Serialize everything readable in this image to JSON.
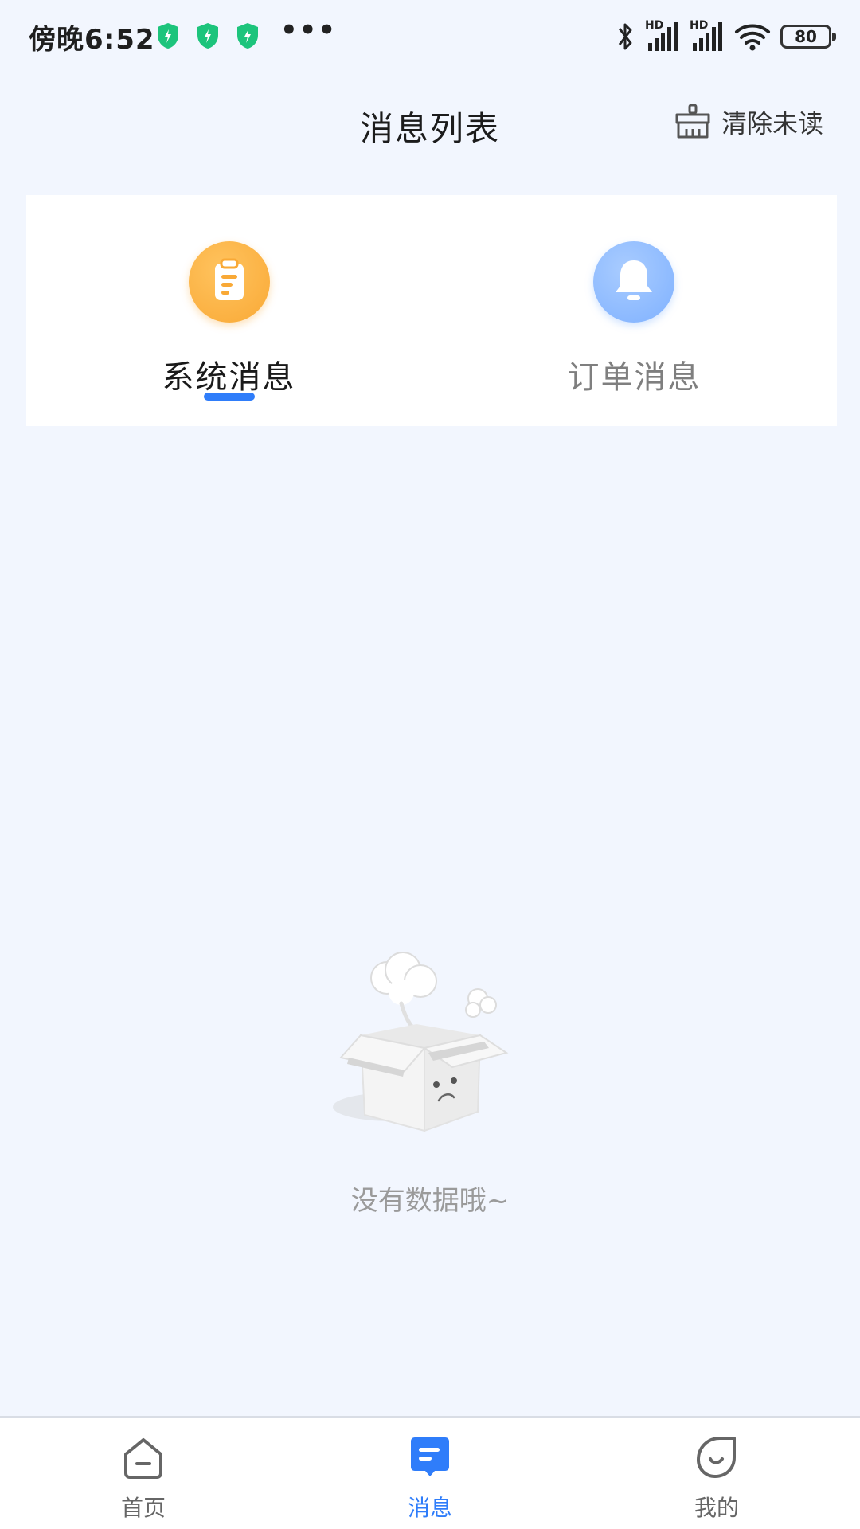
{
  "status_bar": {
    "time": "傍晚6:52",
    "more_indicator": "•••",
    "hd_label": "HD",
    "battery": "80"
  },
  "header": {
    "title": "消息列表",
    "clear_unread": "清除未读"
  },
  "tabs": [
    {
      "label": "系统消息",
      "icon": "clipboard-icon",
      "active": true
    },
    {
      "label": "订单消息",
      "icon": "bell-icon",
      "active": false
    }
  ],
  "empty_state": {
    "text": "没有数据哦~"
  },
  "bottom_nav": [
    {
      "label": "首页",
      "icon": "home-icon"
    },
    {
      "label": "消息",
      "icon": "message-icon",
      "active": true
    },
    {
      "label": "我的",
      "icon": "profile-icon"
    }
  ],
  "colors": {
    "background": "#f2f6fe",
    "accent": "#2f7dfa",
    "system_icon": "#f9a936",
    "order_icon": "#7fb1ff",
    "shield": "#1dc47c"
  }
}
